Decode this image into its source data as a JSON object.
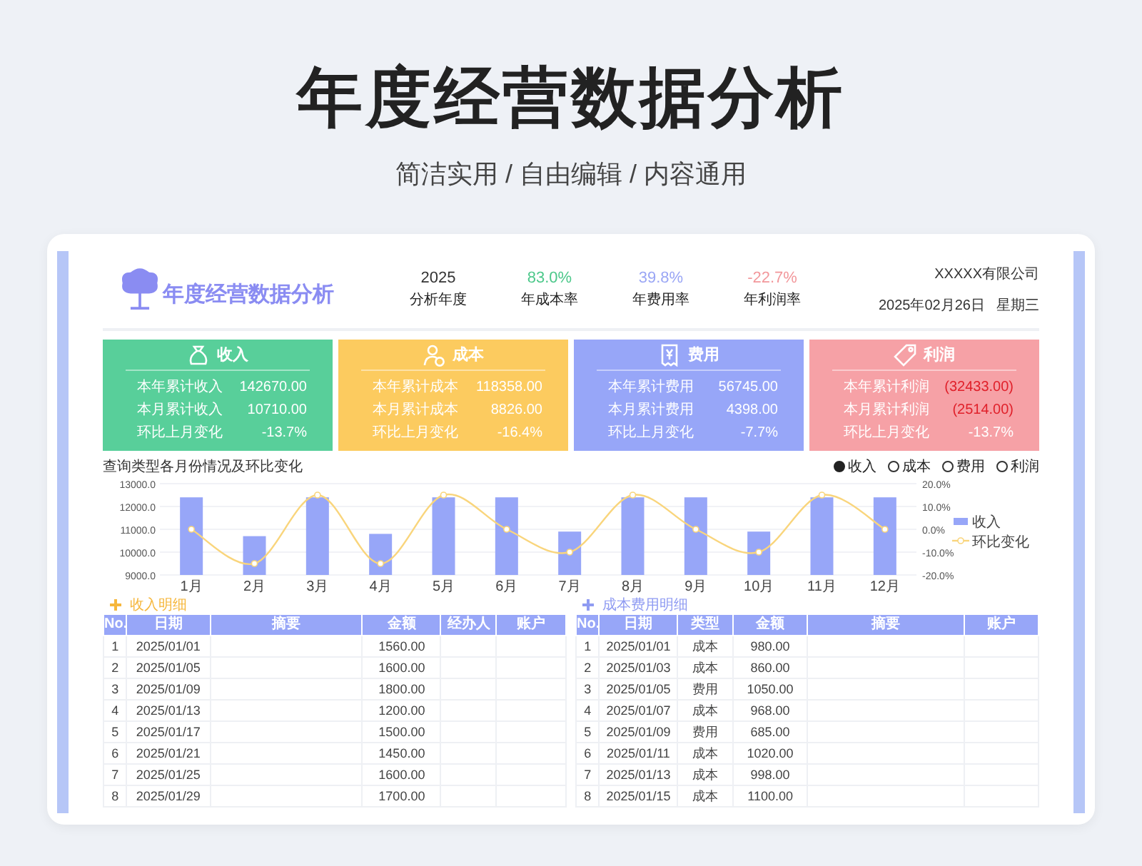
{
  "header": {
    "title": "年度经营数据分析",
    "subtitle": "简洁实用 / 自由编辑 / 内容通用"
  },
  "sheet": {
    "title": "年度经营数据分析",
    "company": "XXXXX有限公司",
    "date": "2025年02月26日",
    "weekday": "星期三",
    "stats": [
      {
        "value": "2025",
        "label": "分析年度",
        "color": "#333333"
      },
      {
        "value": "83.0%",
        "label": "年成本率",
        "color": "#4cc88a"
      },
      {
        "value": "39.8%",
        "label": "年费用率",
        "color": "#9aa6f5"
      },
      {
        "value": "-22.7%",
        "label": "年利润率",
        "color": "#f2979b"
      }
    ]
  },
  "cards": [
    {
      "kind": "income",
      "title": "收入",
      "color": "#58cf9a",
      "rows": [
        {
          "label": "本年累计收入",
          "value": "142670.00",
          "negative": false
        },
        {
          "label": "本月累计收入",
          "value": "10710.00",
          "negative": false
        },
        {
          "label": "环比上月变化",
          "value": "-13.7%",
          "negative": false
        }
      ]
    },
    {
      "kind": "cost",
      "title": "成本",
      "color": "#fccb5f",
      "rows": [
        {
          "label": "本年累计成本",
          "value": "118358.00",
          "negative": false
        },
        {
          "label": "本月累计成本",
          "value": "8826.00",
          "negative": false
        },
        {
          "label": "环比上月变化",
          "value": "-16.4%",
          "negative": false
        }
      ]
    },
    {
      "kind": "expense",
      "title": "费用",
      "color": "#97a6f8",
      "rows": [
        {
          "label": "本年累计费用",
          "value": "56745.00",
          "negative": false
        },
        {
          "label": "本月累计费用",
          "value": "4398.00",
          "negative": false
        },
        {
          "label": "环比上月变化",
          "value": "-7.7%",
          "negative": false
        }
      ]
    },
    {
      "kind": "profit",
      "title": "利润",
      "color": "#f6a1a6",
      "rows": [
        {
          "label": "本年累计利润",
          "value": "(32433.00)",
          "negative": true
        },
        {
          "label": "本月累计利润",
          "value": "(2514.00)",
          "negative": true
        },
        {
          "label": "环比上月变化",
          "value": "-13.7%",
          "negative": false
        }
      ]
    }
  ],
  "chart": {
    "title": "查询类型各月份情况及环比变化",
    "options": [
      {
        "label": "收入",
        "selected": true
      },
      {
        "label": "成本",
        "selected": false
      },
      {
        "label": "费用",
        "selected": false
      },
      {
        "label": "利润",
        "selected": false
      }
    ],
    "chart_data": {
      "type": "bar",
      "grid": true,
      "legend": "right",
      "categories": [
        "1月",
        "2月",
        "3月",
        "4月",
        "5月",
        "6月",
        "7月",
        "8月",
        "9月",
        "10月",
        "11月",
        "12月"
      ],
      "series": [
        {
          "name": "收入",
          "color": "#97a6f8",
          "values": [
            12400,
            10700,
            12400,
            10800,
            12400,
            12400,
            10900,
            12400,
            12400,
            10900,
            12400,
            12400
          ]
        },
        {
          "name": "环比变化",
          "color": "#f9d57c",
          "type": "line",
          "axis": "y2",
          "marker": "circle",
          "values": [
            0,
            -15,
            15,
            -15,
            15,
            0,
            -10,
            15,
            0,
            -10,
            15,
            0
          ]
        }
      ],
      "ylim": [
        9000,
        13000
      ],
      "y2lim": [
        -20,
        20
      ],
      "y2ticks": [
        {
          "value": 20,
          "label": "20.0%"
        },
        {
          "value": 10,
          "label": "10.0%"
        },
        {
          "value": 0,
          "label": "0.0%"
        },
        {
          "value": -10,
          "label": "-10.0%"
        },
        {
          "value": -20,
          "label": "-20.0%"
        }
      ],
      "yticks": [
        {
          "value": 9000,
          "label": "9000.0"
        },
        {
          "value": 10000,
          "label": "10000.0"
        },
        {
          "value": 11000,
          "label": "11000.0"
        },
        {
          "value": 12000,
          "label": "12000.0"
        },
        {
          "value": 13000,
          "label": "13000.0"
        }
      ]
    }
  },
  "tables": [
    {
      "title": "收入明细",
      "color": "#f6b73c",
      "columns": [
        "No.",
        "日期",
        "摘要",
        "金额",
        "经办人",
        "账户"
      ],
      "rows": [
        [
          "1",
          "2025/01/01",
          "",
          "1560.00",
          "",
          ""
        ],
        [
          "2",
          "2025/01/05",
          "",
          "1600.00",
          "",
          ""
        ],
        [
          "3",
          "2025/01/09",
          "",
          "1800.00",
          "",
          ""
        ],
        [
          "4",
          "2025/01/13",
          "",
          "1200.00",
          "",
          ""
        ],
        [
          "5",
          "2025/01/17",
          "",
          "1500.00",
          "",
          ""
        ],
        [
          "6",
          "2025/01/21",
          "",
          "1450.00",
          "",
          ""
        ],
        [
          "7",
          "2025/01/25",
          "",
          "1600.00",
          "",
          ""
        ],
        [
          "8",
          "2025/01/29",
          "",
          "1700.00",
          "",
          ""
        ]
      ]
    },
    {
      "title": "成本费用明细",
      "color": "#8f9bf2",
      "columns": [
        "No.",
        "日期",
        "类型",
        "金额",
        "摘要",
        "账户"
      ],
      "rows": [
        [
          "1",
          "2025/01/01",
          "成本",
          "980.00",
          "",
          ""
        ],
        [
          "2",
          "2025/01/03",
          "成本",
          "860.00",
          "",
          ""
        ],
        [
          "3",
          "2025/01/05",
          "费用",
          "1050.00",
          "",
          ""
        ],
        [
          "4",
          "2025/01/07",
          "成本",
          "968.00",
          "",
          ""
        ],
        [
          "5",
          "2025/01/09",
          "费用",
          "685.00",
          "",
          ""
        ],
        [
          "6",
          "2025/01/11",
          "成本",
          "1020.00",
          "",
          ""
        ],
        [
          "7",
          "2025/01/13",
          "成本",
          "998.00",
          "",
          ""
        ],
        [
          "8",
          "2025/01/15",
          "成本",
          "1100.00",
          "",
          ""
        ]
      ]
    }
  ]
}
